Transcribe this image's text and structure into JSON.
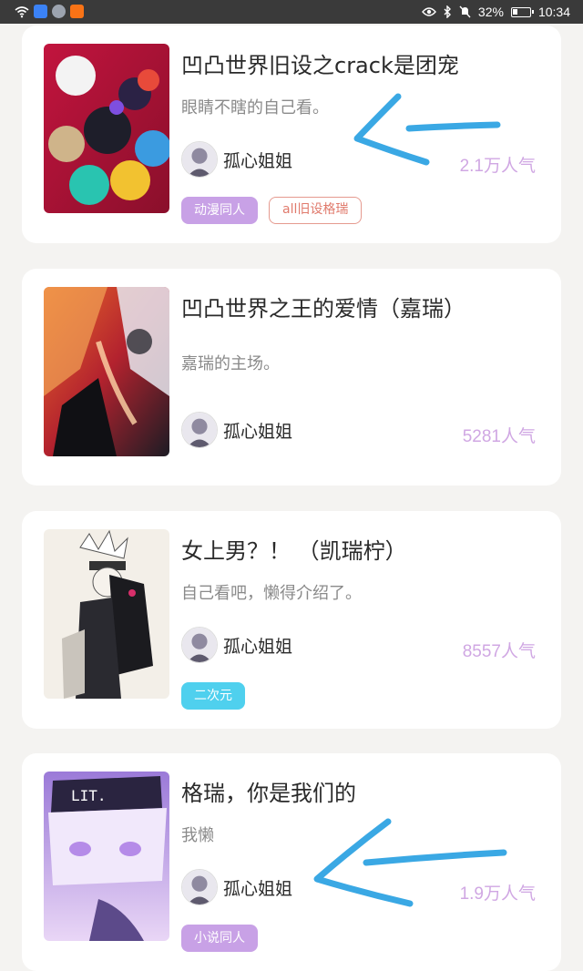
{
  "status_bar": {
    "battery": "32%",
    "time": "10:34",
    "battery_level": 0.32
  },
  "works": [
    {
      "title": "凹凸世界旧设之crack是团宠",
      "description": "眼睛不瞎的自己看。",
      "author": "孤心姐姐",
      "popularity": "2.1万人气",
      "tags": [
        "动漫同人",
        "all旧设格瑞"
      ]
    },
    {
      "title": "凹凸世界之王的爱情（嘉瑞）",
      "description": "嘉瑞的主场。",
      "author": "孤心姐姐",
      "popularity": "5281人气",
      "tags": []
    },
    {
      "title": "女上男？！ （凯瑞柠）",
      "description": "自己看吧，懒得介绍了。",
      "author": "孤心姐姐",
      "popularity": "8557人气",
      "tags": [
        "二次元"
      ]
    },
    {
      "title": "格瑞，你是我们的",
      "description": "我懒",
      "author": "孤心姐姐",
      "popularity": "1.9万人气",
      "tags": [
        "小说同人"
      ]
    }
  ],
  "colors": {
    "tag_purple": "#c8a1e6",
    "tag_cyan": "#4fd0ee",
    "tag_outline": "#e07a6c",
    "popularity": "#d0a7e3",
    "annotation_arrow": "#3aa8e4"
  },
  "icons": [
    "wifi-icon",
    "bluetooth-icon",
    "mute-icon",
    "eye-icon",
    "battery-icon"
  ]
}
